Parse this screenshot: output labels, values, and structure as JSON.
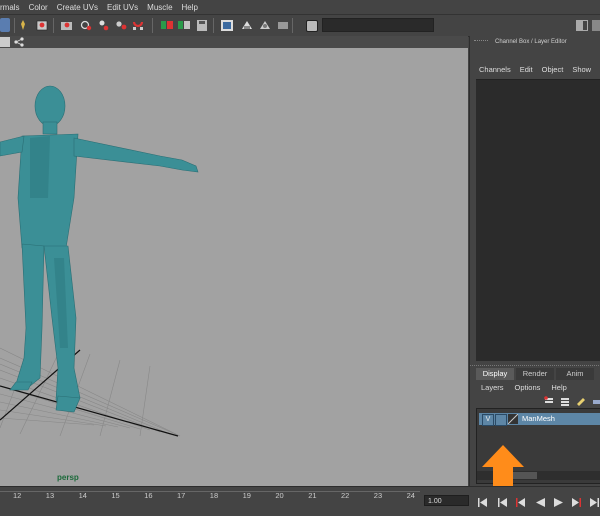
{
  "menu": [
    "rmals",
    "Color",
    "Create UVs",
    "Edit UVs",
    "Muscle",
    "Help"
  ],
  "toolbar_icons": [
    "help-icon",
    "lasso-icon",
    "select-icon",
    "translate-icon",
    "rotate-icon",
    "scale-icon",
    "snap-icon",
    "magnet-icon",
    "render-icon",
    "ipr-icon",
    "render-settings-icon",
    "hypershade-icon",
    "film-icon",
    "shading-icon",
    "input-icon"
  ],
  "viewport": {
    "camera_label": "persp"
  },
  "channel_box": {
    "title": "Channel Box / Layer Editor",
    "menu": [
      "Channels",
      "Edit",
      "Object",
      "Show"
    ]
  },
  "layer_editor": {
    "tabs": [
      "Display",
      "Render",
      "Anim"
    ],
    "active_tab": "Display",
    "menu": [
      "Layers",
      "Options",
      "Help"
    ],
    "layers": [
      {
        "visibility": "V",
        "name": "ManMesh"
      }
    ]
  },
  "timeline": {
    "ticks": [
      "12",
      "13",
      "14",
      "15",
      "16",
      "17",
      "18",
      "19",
      "20",
      "21",
      "22",
      "23",
      "24"
    ],
    "current_time": "1.00"
  },
  "colors": {
    "mesh": "#3b8f96",
    "arrow": "#ff8c1a",
    "layer_highlight": "#5d86a6"
  }
}
